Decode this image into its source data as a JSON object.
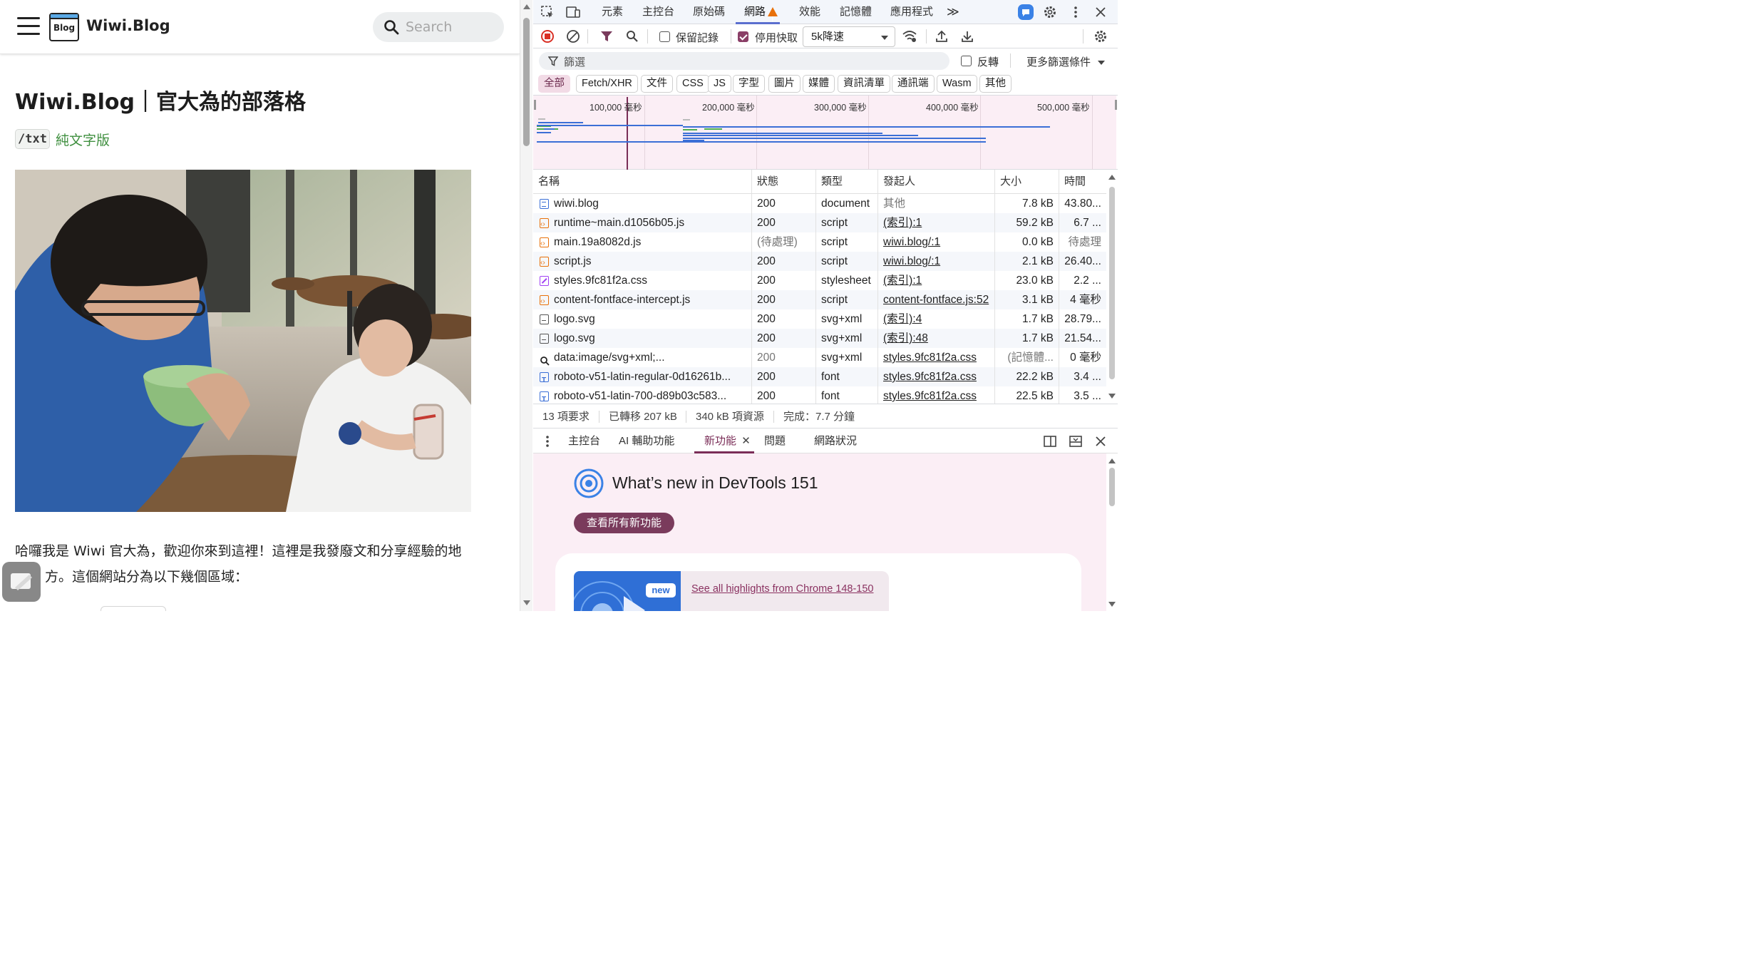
{
  "site": {
    "name": "Wiwi.Blog",
    "logo_text": "Blog",
    "search_placeholder": "Search",
    "post_title": "Wiwi.Blog｜官大為的部落格",
    "txt_code": "/txt",
    "txt_label": "純文字版",
    "intro_line1": "哈囉我是 Wiwi 官大為，歡迎你來到這裡！這裡是我發廢文和分享經驗的地",
    "intro_line2": "方。這個網站分為以下幾個區域："
  },
  "devtools": {
    "tabs": [
      "元素",
      "主控台",
      "原始碼",
      "網路",
      "效能",
      "記憶體",
      "應用程式"
    ],
    "active_tab": "網路",
    "more_tabs": "≫",
    "toolbar": {
      "preserve_log": "保留記錄",
      "preserve_log_checked": false,
      "disable_cache": "停用快取",
      "disable_cache_checked": true,
      "throttle": "5k降速"
    },
    "filter": {
      "placeholder": "篩選",
      "invert": "反轉",
      "more_filters": "更多篩選條件"
    },
    "type_filters": [
      "全部",
      "Fetch/XHR",
      "文件",
      "CSS",
      "JS",
      "字型",
      "圖片",
      "媒體",
      "資訊清單",
      "通訊端",
      "Wasm",
      "其他"
    ],
    "active_type": "全部",
    "timeline_ticks": [
      "100,000 毫秒",
      "200,000 毫秒",
      "300,000 毫秒",
      "400,000 毫秒",
      "500,000 毫秒"
    ],
    "columns": [
      "名稱",
      "狀態",
      "類型",
      "發起人",
      "大小",
      "時間"
    ],
    "requests": [
      {
        "icon": "doc",
        "name": "wiwi.blog",
        "status": "200",
        "type": "document",
        "initiator": "其他",
        "initiator_link": false,
        "size": "7.8 kB",
        "time": "43.80..."
      },
      {
        "icon": "script",
        "name": "runtime~main.d1056b05.js",
        "status": "200",
        "type": "script",
        "initiator": "(索引):1",
        "initiator_link": true,
        "size": "59.2 kB",
        "time": "6.7 ..."
      },
      {
        "icon": "script",
        "name": "main.19a8082d.js",
        "status": "(待處理)",
        "type": "script",
        "initiator": "wiwi.blog/:1",
        "initiator_link": true,
        "size": "0.0 kB",
        "time": "待處理"
      },
      {
        "icon": "script",
        "name": "script.js",
        "status": "200",
        "type": "script",
        "initiator": "wiwi.blog/:1",
        "initiator_link": true,
        "size": "2.1 kB",
        "time": "26.40..."
      },
      {
        "icon": "css",
        "name": "styles.9fc81f2a.css",
        "status": "200",
        "type": "stylesheet",
        "initiator": "(索引):1",
        "initiator_link": true,
        "size": "23.0 kB",
        "time": "2.2 ..."
      },
      {
        "icon": "script",
        "name": "content-fontface-intercept.js",
        "status": "200",
        "type": "script",
        "initiator": "content-fontface.js:52",
        "initiator_link": true,
        "size": "3.1 kB",
        "time": "4 毫秒"
      },
      {
        "icon": "img",
        "name": "logo.svg",
        "status": "200",
        "type": "svg+xml",
        "initiator": "(索引):4",
        "initiator_link": true,
        "size": "1.7 kB",
        "time": "28.79..."
      },
      {
        "icon": "img",
        "name": "logo.svg",
        "status": "200",
        "type": "svg+xml",
        "initiator": "(索引):48",
        "initiator_link": true,
        "size": "1.7 kB",
        "time": "21.54..."
      },
      {
        "icon": "data",
        "name": "data:image/svg+xml;...",
        "status": "200",
        "type": "svg+xml",
        "initiator": "styles.9fc81f2a.css",
        "initiator_link": true,
        "size": "(記憶體...",
        "time": "0 毫秒"
      },
      {
        "icon": "font",
        "name": "roboto-v51-latin-regular-0d16261b...",
        "status": "200",
        "type": "font",
        "initiator": "styles.9fc81f2a.css",
        "initiator_link": true,
        "size": "22.2 kB",
        "time": "3.4 ..."
      },
      {
        "icon": "font",
        "name": "roboto-v51-latin-700-d89b03c583...",
        "status": "200",
        "type": "font",
        "initiator": "styles.9fc81f2a.css",
        "initiator_link": true,
        "size": "22.5 kB",
        "time": "3.5 ..."
      }
    ],
    "status_bar": {
      "requests": "13 項要求",
      "transferred": "已轉移 207 kB",
      "resources": "340 kB 項資源",
      "finish": "完成：7.7 分鐘"
    },
    "drawer_tabs": [
      "主控台",
      "AI 輔助功能",
      "新功能",
      "問題",
      "網路狀況"
    ],
    "active_drawer_tab": "新功能",
    "whats_new": {
      "title": "What’s new in DevTools 151",
      "button": "查看所有新功能",
      "badge": "new",
      "link": "See all highlights from Chrome 148-150"
    },
    "colors": {
      "accent": "#7a3b5c",
      "active_chip_bg": "#f2dbe6",
      "tab_underline": "#5b6fcf",
      "warning": "#e8710a"
    }
  }
}
